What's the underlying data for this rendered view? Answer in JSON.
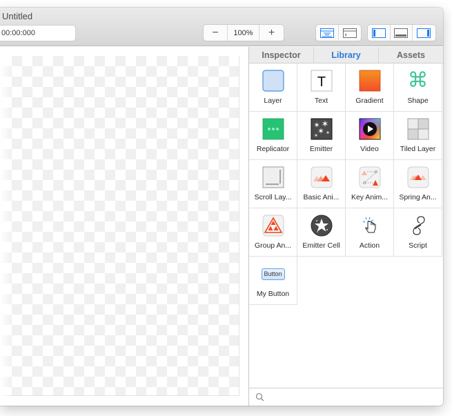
{
  "window": {
    "title": "Untitled"
  },
  "toolbar": {
    "timecode": "00:00:000",
    "zoom_out_label": "−",
    "zoom_level": "100%",
    "zoom_in_label": "+",
    "view_buttons": [
      {
        "name": "timeline-view",
        "icon": "timeline-icon",
        "active": true
      },
      {
        "name": "console-view",
        "icon": "console-icon",
        "active": false
      }
    ],
    "panel_buttons": [
      {
        "name": "left-panel",
        "icon": "left-sidebar-icon",
        "active": true
      },
      {
        "name": "bottom-panel",
        "icon": "bottom-panel-icon",
        "active": false
      },
      {
        "name": "right-panel",
        "icon": "right-sidebar-icon",
        "active": true
      }
    ]
  },
  "panel": {
    "tabs": [
      {
        "label": "Inspector",
        "active": false
      },
      {
        "label": "Library",
        "active": true
      },
      {
        "label": "Assets",
        "active": false
      }
    ],
    "library_items": [
      {
        "label": "Layer",
        "icon": "layer-icon"
      },
      {
        "label": "Text",
        "icon": "text-icon"
      },
      {
        "label": "Gradient",
        "icon": "gradient-icon"
      },
      {
        "label": "Shape",
        "icon": "shape-icon"
      },
      {
        "label": "Replicator",
        "icon": "replicator-icon"
      },
      {
        "label": "Emitter",
        "icon": "emitter-icon"
      },
      {
        "label": "Video",
        "icon": "video-icon"
      },
      {
        "label": "Tiled Layer",
        "icon": "tiled-layer-icon"
      },
      {
        "label": "Scroll Lay...",
        "icon": "scroll-layer-icon"
      },
      {
        "label": "Basic Ani...",
        "icon": "basic-animation-icon"
      },
      {
        "label": "Key Anim...",
        "icon": "key-animation-icon"
      },
      {
        "label": "Spring An...",
        "icon": "spring-animation-icon"
      },
      {
        "label": "Group An...",
        "icon": "group-animation-icon"
      },
      {
        "label": "Emitter Cell",
        "icon": "emitter-cell-icon"
      },
      {
        "label": "Action",
        "icon": "action-icon"
      },
      {
        "label": "Script",
        "icon": "script-icon"
      },
      {
        "label": "My Button",
        "icon": "button-icon",
        "preview_text": "Button"
      }
    ],
    "search": {
      "value": "",
      "placeholder": ""
    }
  },
  "colors": {
    "accent": "#2c78dc",
    "active_icon": "#1b7cf2"
  }
}
